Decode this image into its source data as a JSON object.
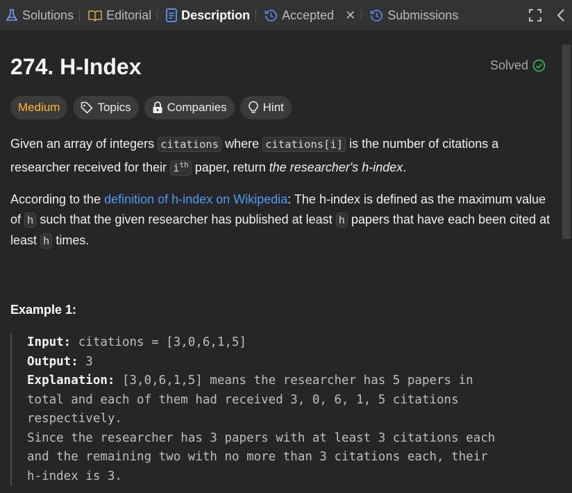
{
  "tabs": [
    {
      "label": "Solutions"
    },
    {
      "label": "Editorial"
    },
    {
      "label": "Description"
    },
    {
      "label": "Accepted"
    },
    {
      "label": "Submissions"
    }
  ],
  "problem": {
    "title": "274. H-Index",
    "status": "Solved"
  },
  "tags": {
    "difficulty": "Medium",
    "topics": "Topics",
    "companies": "Companies",
    "hint": "Hint"
  },
  "description": {
    "p1_a": "Given an array of integers ",
    "p1_code1": "citations",
    "p1_b": " where ",
    "p1_code2": "citations[i]",
    "p1_c": " is the number of citations a researcher received for their ",
    "p1_code3": "i",
    "p1_sup": "th",
    "p1_d": " paper, return ",
    "p1_em": "the researcher's h-index",
    "p1_e": ".",
    "p2_a": "According to the ",
    "p2_link": "definition of h-index on Wikipedia",
    "p2_b": ": The h-index is defined as the maximum value of ",
    "p2_code1": "h",
    "p2_c": " such that the given researcher has published at least ",
    "p2_code2": "h",
    "p2_d": " papers that have each been cited at least ",
    "p2_code3": "h",
    "p2_e": " times."
  },
  "example1": {
    "title": "Example 1:",
    "input_label": "Input:",
    "input_value": " citations = [3,0,6,1,5]",
    "output_label": "Output:",
    "output_value": " 3",
    "explanation_label": "Explanation:",
    "explanation_lines": [
      " [3,0,6,1,5] means the researcher has 5 papers in",
      "total and each of them had received 3, 0, 6, 1, 5 citations",
      "respectively.",
      "Since the researcher has 3 papers with at least 3 citations each",
      "and the remaining two with no more than 3 citations each, their",
      "h-index is 3."
    ]
  },
  "colors": {
    "background": "#262626",
    "tabbar": "#333333",
    "medium": "#ffb92e",
    "link": "#4c9cf8",
    "solved_check": "#2cbb5d",
    "solutions_icon": "#7aa2ff",
    "accepted_icon": "#5a8dee"
  },
  "icons": [
    "beaker-icon",
    "book-icon",
    "document-icon",
    "history-icon",
    "close-icon",
    "history-icon",
    "fullscreen-icon",
    "chevron-left-icon",
    "tag-icon",
    "lock-icon",
    "lightbulb-icon",
    "check-circle-icon"
  ]
}
